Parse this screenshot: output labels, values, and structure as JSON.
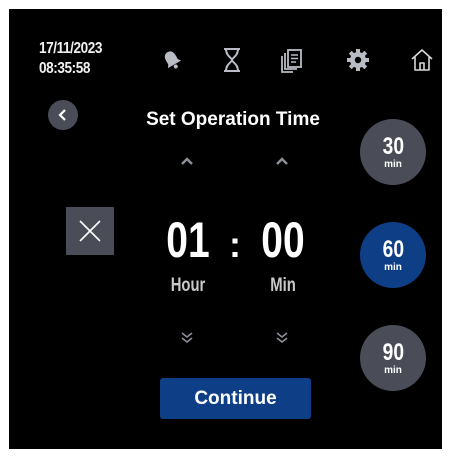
{
  "status": {
    "date": "17/11/2023",
    "time": "08:35:58"
  },
  "toolbar": {
    "icons": [
      "bell-icon",
      "hourglass-icon",
      "documents-icon",
      "gear-icon",
      "home-icon"
    ]
  },
  "header": {
    "title": "Set Operation Time"
  },
  "timer": {
    "hours": "01",
    "minutes": "00",
    "separator": ":",
    "hour_label": "Hour",
    "minute_label": "Min"
  },
  "presets": [
    {
      "value": "30",
      "unit": "min",
      "active": false
    },
    {
      "value": "60",
      "unit": "min",
      "active": true
    },
    {
      "value": "90",
      "unit": "min",
      "active": false
    }
  ],
  "actions": {
    "continue_label": "Continue"
  },
  "colors": {
    "background": "#000000",
    "control_gray": "#4a4d57",
    "accent_blue": "#0e3f86",
    "text": "#ffffff"
  }
}
